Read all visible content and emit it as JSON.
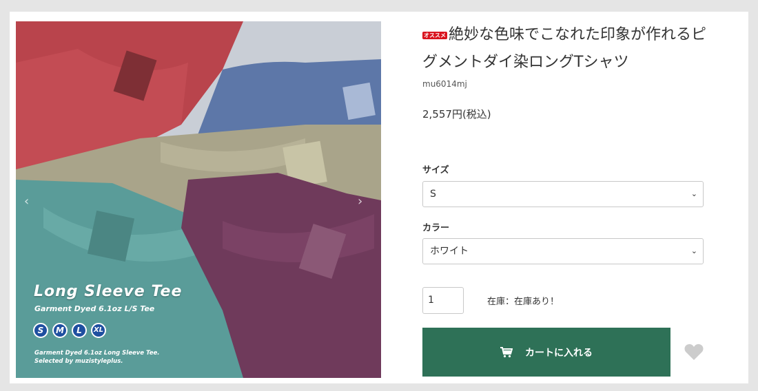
{
  "product_image": {
    "overlay_title": "Long Sleeve Tee",
    "overlay_subtitle": "Garment Dyed 6.1oz L/S Tee",
    "sizes": [
      "S",
      "M",
      "L",
      "XL"
    ],
    "footer_line1": "Garment Dyed 6.1oz Long Sleeve Tee.",
    "footer_line2": "Selected by muzistyleplus."
  },
  "product": {
    "recommend_badge": "オススメ",
    "title": "絶妙な色味でこなれた印象が作れるピグメントダイ染ロングTシャツ",
    "sku": "mu6014mj",
    "price": "2,557円(税込)"
  },
  "options": {
    "size_label": "サイズ",
    "size_value": "S",
    "color_label": "カラー",
    "color_value": "ホワイト"
  },
  "purchase": {
    "quantity": "1",
    "stock_text": "在庫：在庫あり！",
    "cart_label": "カートに入れる"
  },
  "colors": {
    "cart_button": "#2e7157",
    "badge_red": "#d9141e",
    "size_badge_blue": "#1f4fa0"
  },
  "icons": {
    "cart": "cart-icon",
    "favorite": "heart-icon",
    "select_arrow": "chevron-down-icon"
  }
}
